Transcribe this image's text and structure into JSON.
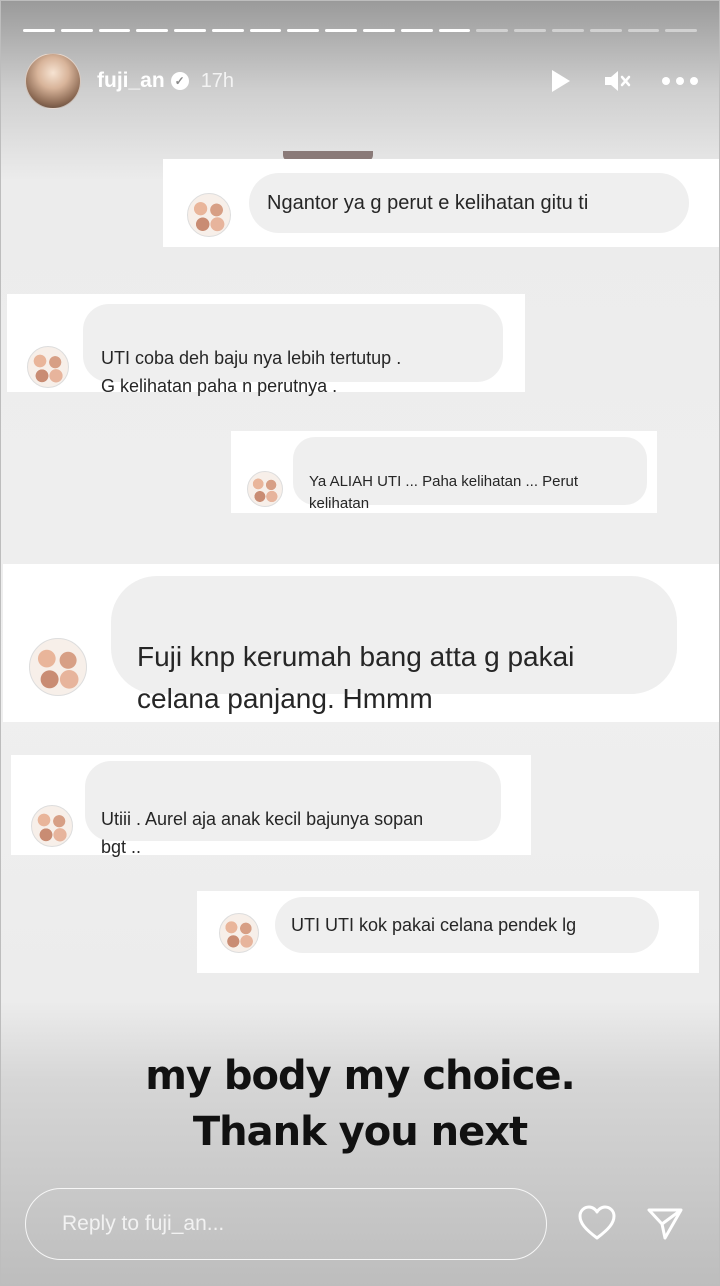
{
  "story": {
    "username": "fuji_an",
    "timestamp": "17h",
    "progress_total": 18,
    "progress_done": 12
  },
  "icons": {
    "verified": "✓",
    "play": "play-icon",
    "mute": "mute-icon",
    "more": "more-icon",
    "heart": "heart-icon",
    "send": "send-icon"
  },
  "messages": [
    {
      "text": "Ngantor ya g perut e kelihatan gitu ti"
    },
    {
      "text": "UTI coba deh baju nya lebih tertutup .\nG kelihatan paha n perutnya ."
    },
    {
      "text": "Ya ALIAH UTI ... Paha kelihatan ... Perut\nkelihatan"
    },
    {
      "text": "Fuji knp kerumah bang atta g pakai\ncelana panjang.   Hmmm"
    },
    {
      "text": "Utiii . Aurel aja anak kecil bajunya sopan\nbgt .."
    },
    {
      "text": "UTI UTI kok pakai celana pendek lg"
    }
  ],
  "caption": {
    "line1": "my body my choice.",
    "line2": "Thank you next"
  },
  "reply": {
    "placeholder": "Reply to fuji_an..."
  },
  "colors": {
    "bubble": "#efefef",
    "chat_bg": "#ffffff",
    "text": "#262626"
  }
}
